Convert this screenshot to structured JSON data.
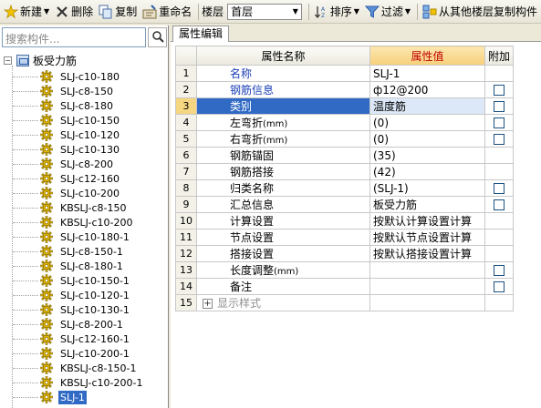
{
  "toolbar": {
    "new_label": "新建",
    "delete_label": "删除",
    "copy_label": "复制",
    "rename_label": "重命名",
    "floor_label": "楼层",
    "floor_value": "首层",
    "sort_label": "排序",
    "filter_label": "过滤",
    "copy_from_floor_label": "从其他楼层复制构件"
  },
  "search": {
    "placeholder": "搜索构件..."
  },
  "tree": {
    "root_label": "板受力筋",
    "items": [
      "SLJ-c10-180",
      "SLJ-c8-150",
      "SLJ-c8-180",
      "SLJ-c10-150",
      "SLJ-c10-120",
      "SLJ-c10-130",
      "SLJ-c8-200",
      "SLJ-c12-160",
      "SLJ-c10-200",
      "KBSLJ-c8-150",
      "KBSLJ-c10-200",
      "SLJ-c10-180-1",
      "SLJ-c8-150-1",
      "SLJ-c8-180-1",
      "SLJ-c10-150-1",
      "SLJ-c10-120-1",
      "SLJ-c10-130-1",
      "SLJ-c8-200-1",
      "SLJ-c12-160-1",
      "SLJ-c10-200-1",
      "KBSLJ-c8-150-1",
      "KBSLJ-c10-200-1",
      "SLJ-1"
    ],
    "selected": "SLJ-1"
  },
  "props": {
    "tab_label": "属性编辑",
    "col_name": "属性名称",
    "col_value": "属性值",
    "col_extra": "附加",
    "rows": [
      {
        "num": "1",
        "name": "名称",
        "unit": "",
        "value": "SLJ-1"
      },
      {
        "num": "2",
        "name": "钢筋信息",
        "unit": "",
        "value": "ф12@200"
      },
      {
        "num": "3",
        "name": "类别",
        "unit": "",
        "value": "温度筋"
      },
      {
        "num": "4",
        "name": "左弯折",
        "unit": "(mm)",
        "value": "(0)"
      },
      {
        "num": "5",
        "name": "右弯折",
        "unit": "(mm)",
        "value": "(0)"
      },
      {
        "num": "6",
        "name": "钢筋锚固",
        "unit": "",
        "value": "(35)"
      },
      {
        "num": "7",
        "name": "钢筋搭接",
        "unit": "",
        "value": "(42)"
      },
      {
        "num": "8",
        "name": "归类名称",
        "unit": "",
        "value": "(SLJ-1)"
      },
      {
        "num": "9",
        "name": "汇总信息",
        "unit": "",
        "value": "板受力筋"
      },
      {
        "num": "10",
        "name": "计算设置",
        "unit": "",
        "value": "按默认计算设置计算"
      },
      {
        "num": "11",
        "name": "节点设置",
        "unit": "",
        "value": "按默认节点设置计算"
      },
      {
        "num": "12",
        "name": "搭接设置",
        "unit": "",
        "value": "按默认搭接设置计算"
      },
      {
        "num": "13",
        "name": "长度调整",
        "unit": "(mm)",
        "value": ""
      },
      {
        "num": "14",
        "name": "备注",
        "unit": "",
        "value": ""
      },
      {
        "num": "15",
        "name": "显示样式",
        "unit": "",
        "value": ""
      }
    ]
  },
  "colors": {
    "selection": "#316ac5",
    "header_value": "#c00000",
    "name_blue": "#1a3fb5"
  }
}
